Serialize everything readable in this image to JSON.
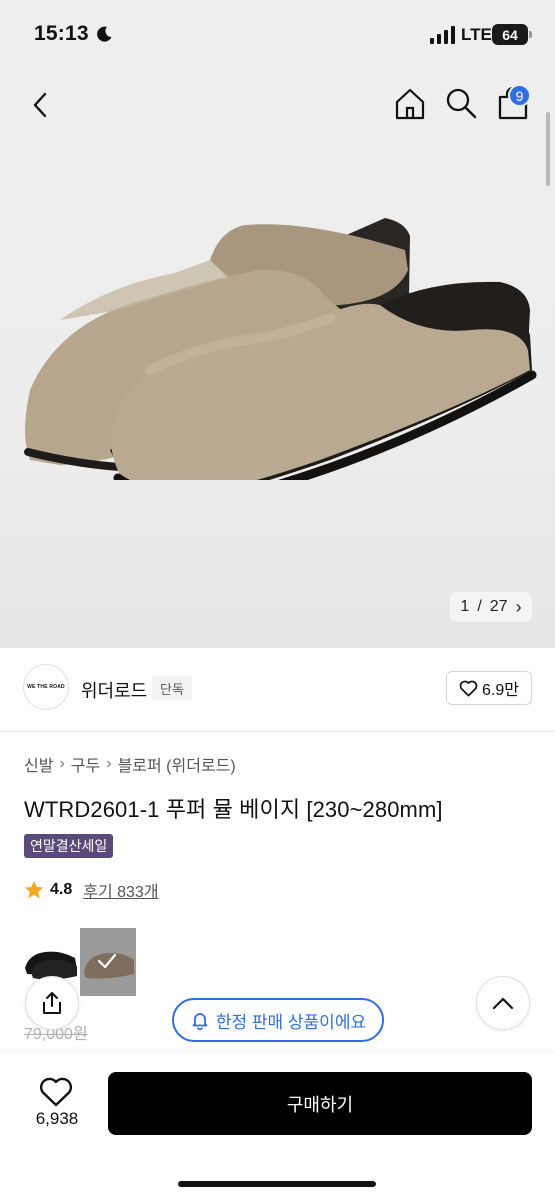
{
  "status_bar": {
    "time": "15:13",
    "network": "LTE",
    "battery": "64"
  },
  "nav": {
    "cart_count": "9"
  },
  "image_counter": {
    "current": "1",
    "separator": "/",
    "total": "27",
    "next_glyph": "›"
  },
  "brand": {
    "logo_text": "WE THE ROAD",
    "name": "위더로드",
    "tag": "단독",
    "likes": "6.9만"
  },
  "breadcrumb": [
    "신발",
    "구두",
    "블로퍼 (위더로드)"
  ],
  "product": {
    "title": "WTRD2601-1 푸퍼 뮬 베이지 [230~280mm]",
    "sale_badge": "연말결산세일",
    "rating": "4.8",
    "review_label": "후기 833개",
    "original_price": "79,000원"
  },
  "limited_notice": "한정 판매 상품이에요",
  "bottom_bar": {
    "wish_count": "6,938",
    "buy_label": "구매하기"
  },
  "colors": {
    "accent_blue": "#2f6ee6",
    "sale_purple": "#5a4a7a",
    "shoe_beige": "#b5a48c",
    "star": "#f5a623"
  }
}
